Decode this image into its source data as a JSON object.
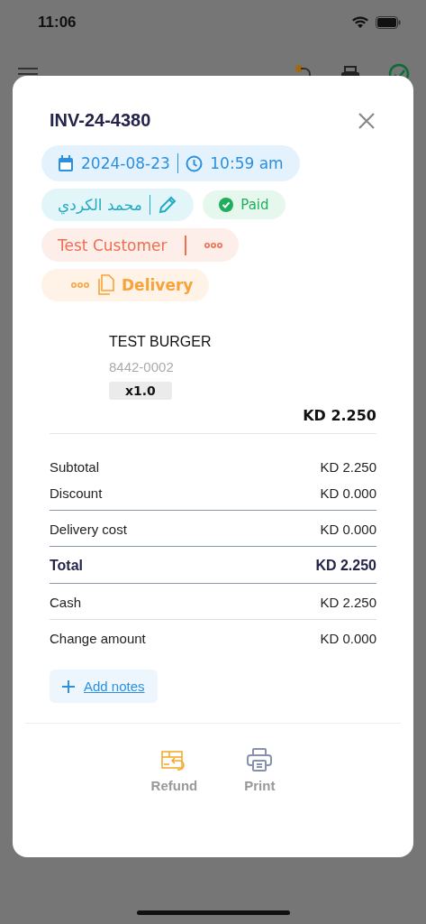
{
  "status_bar": {
    "time": "11:06"
  },
  "invoice": {
    "number": "INV-24-4380",
    "date": "2024-08-23",
    "time": "10:59 am",
    "cashier": "محمد الكردي",
    "payment_status": "Paid",
    "customer": "Test Customer",
    "order_type": "Delivery"
  },
  "items": [
    {
      "name": "TEST BURGER",
      "code": "8442-0002",
      "quantity": "x1.0",
      "price": "KD 2.250"
    }
  ],
  "summary_sections": [
    [
      {
        "label": "Subtotal",
        "value": "KD 2.250",
        "bold": false
      },
      {
        "label": "Discount",
        "value": "KD 0.000",
        "bold": false
      }
    ],
    [
      {
        "label": "Delivery cost",
        "value": "KD 0.000",
        "bold": false
      }
    ],
    [
      {
        "label": "Total",
        "value": "KD 2.250",
        "bold": true
      }
    ],
    [
      {
        "label": "Cash",
        "value": "KD 2.250",
        "bold": false
      }
    ],
    [
      {
        "label": "Change amount",
        "value": "KD 0.000",
        "bold": false
      }
    ]
  ],
  "add_notes": "Add notes",
  "actions": [
    {
      "kind": "refund",
      "label": "Refund"
    },
    {
      "kind": "print",
      "label": "Print"
    }
  ]
}
